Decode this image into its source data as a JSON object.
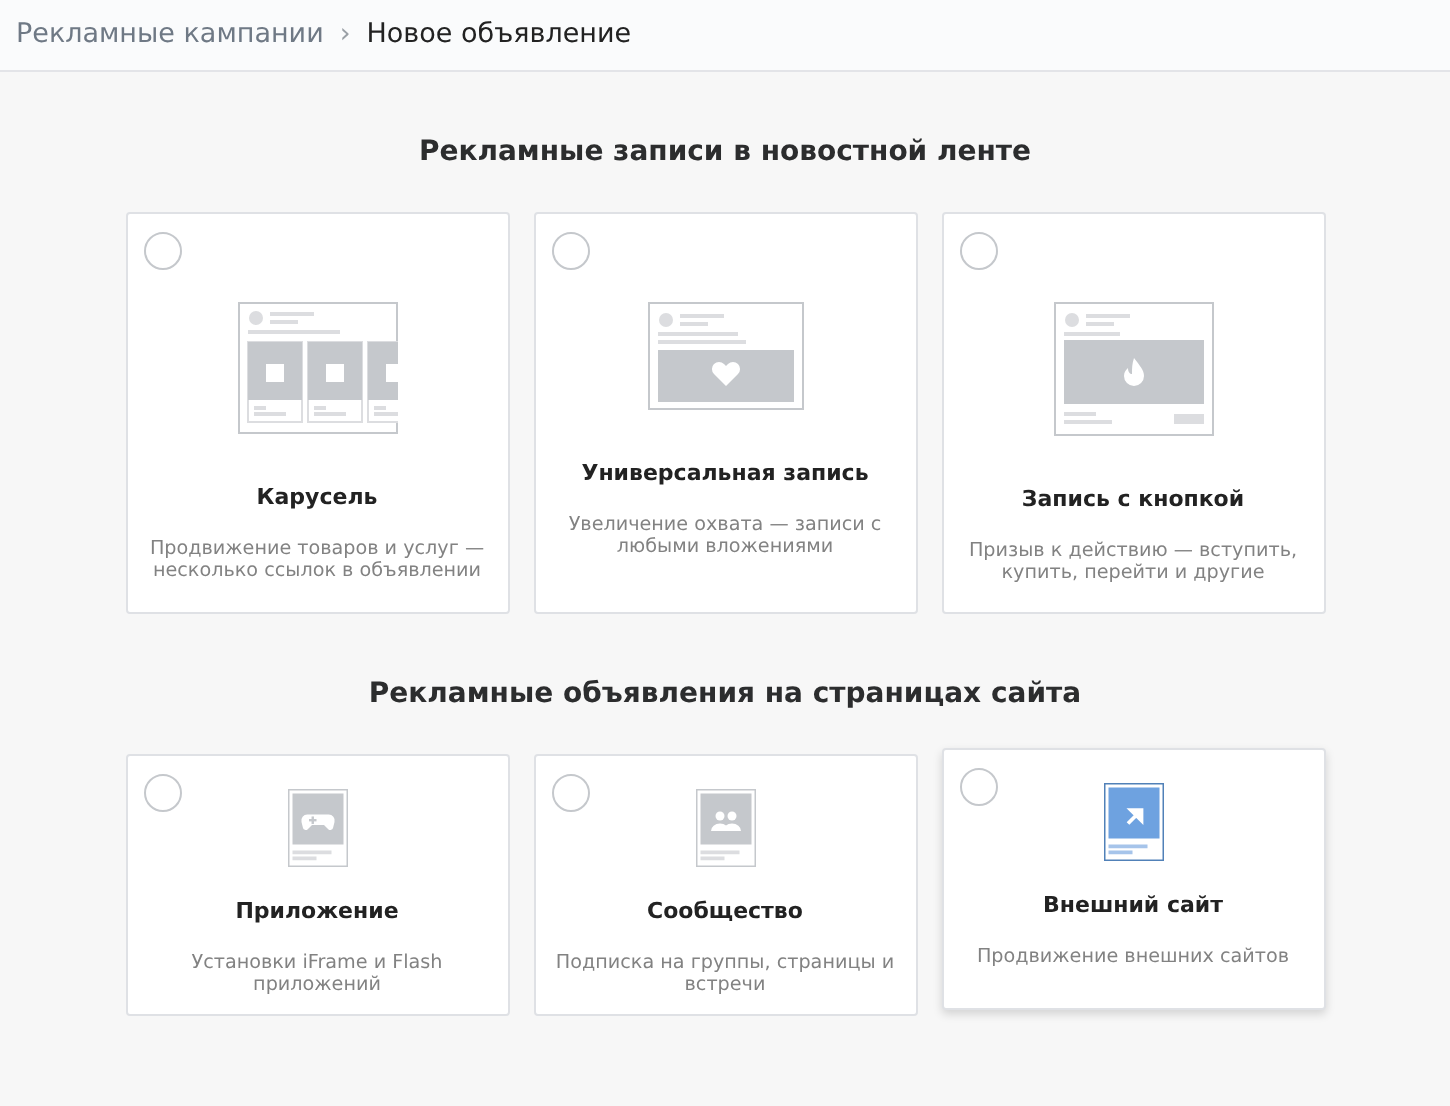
{
  "breadcrumb": {
    "parent": "Рекламные кампании",
    "separator": "›",
    "current": "Новое объявление"
  },
  "sections": [
    {
      "title": "Рекламные записи в новостной ленте",
      "cards": [
        {
          "kind": "carousel",
          "title": "Карусель",
          "description": "Продвижение товаров и услуг — несколько ссылок в объявлении",
          "selected": false,
          "hovered": false
        },
        {
          "kind": "universal",
          "title": "Универсальная запись",
          "description": "Увеличение охвата — записи с любыми вложениями",
          "selected": false,
          "hovered": false
        },
        {
          "kind": "button",
          "title": "Запись с кнопкой",
          "description": "Призыв к действию — вступить, купить, перейти и другие",
          "selected": false,
          "hovered": false
        }
      ]
    },
    {
      "title": "Рекламные объявления на страницах сайта",
      "cards": [
        {
          "kind": "app",
          "title": "Приложение",
          "description": "Установки iFrame и Flash приложений",
          "selected": false,
          "hovered": false
        },
        {
          "kind": "community",
          "title": "Сообщество",
          "description": "Подписка на группы, страницы и встречи",
          "selected": false,
          "hovered": false
        },
        {
          "kind": "site",
          "title": "Внешний сайт",
          "description": "Продвижение внешних сайтов",
          "selected": false,
          "hovered": true
        }
      ]
    }
  ]
}
